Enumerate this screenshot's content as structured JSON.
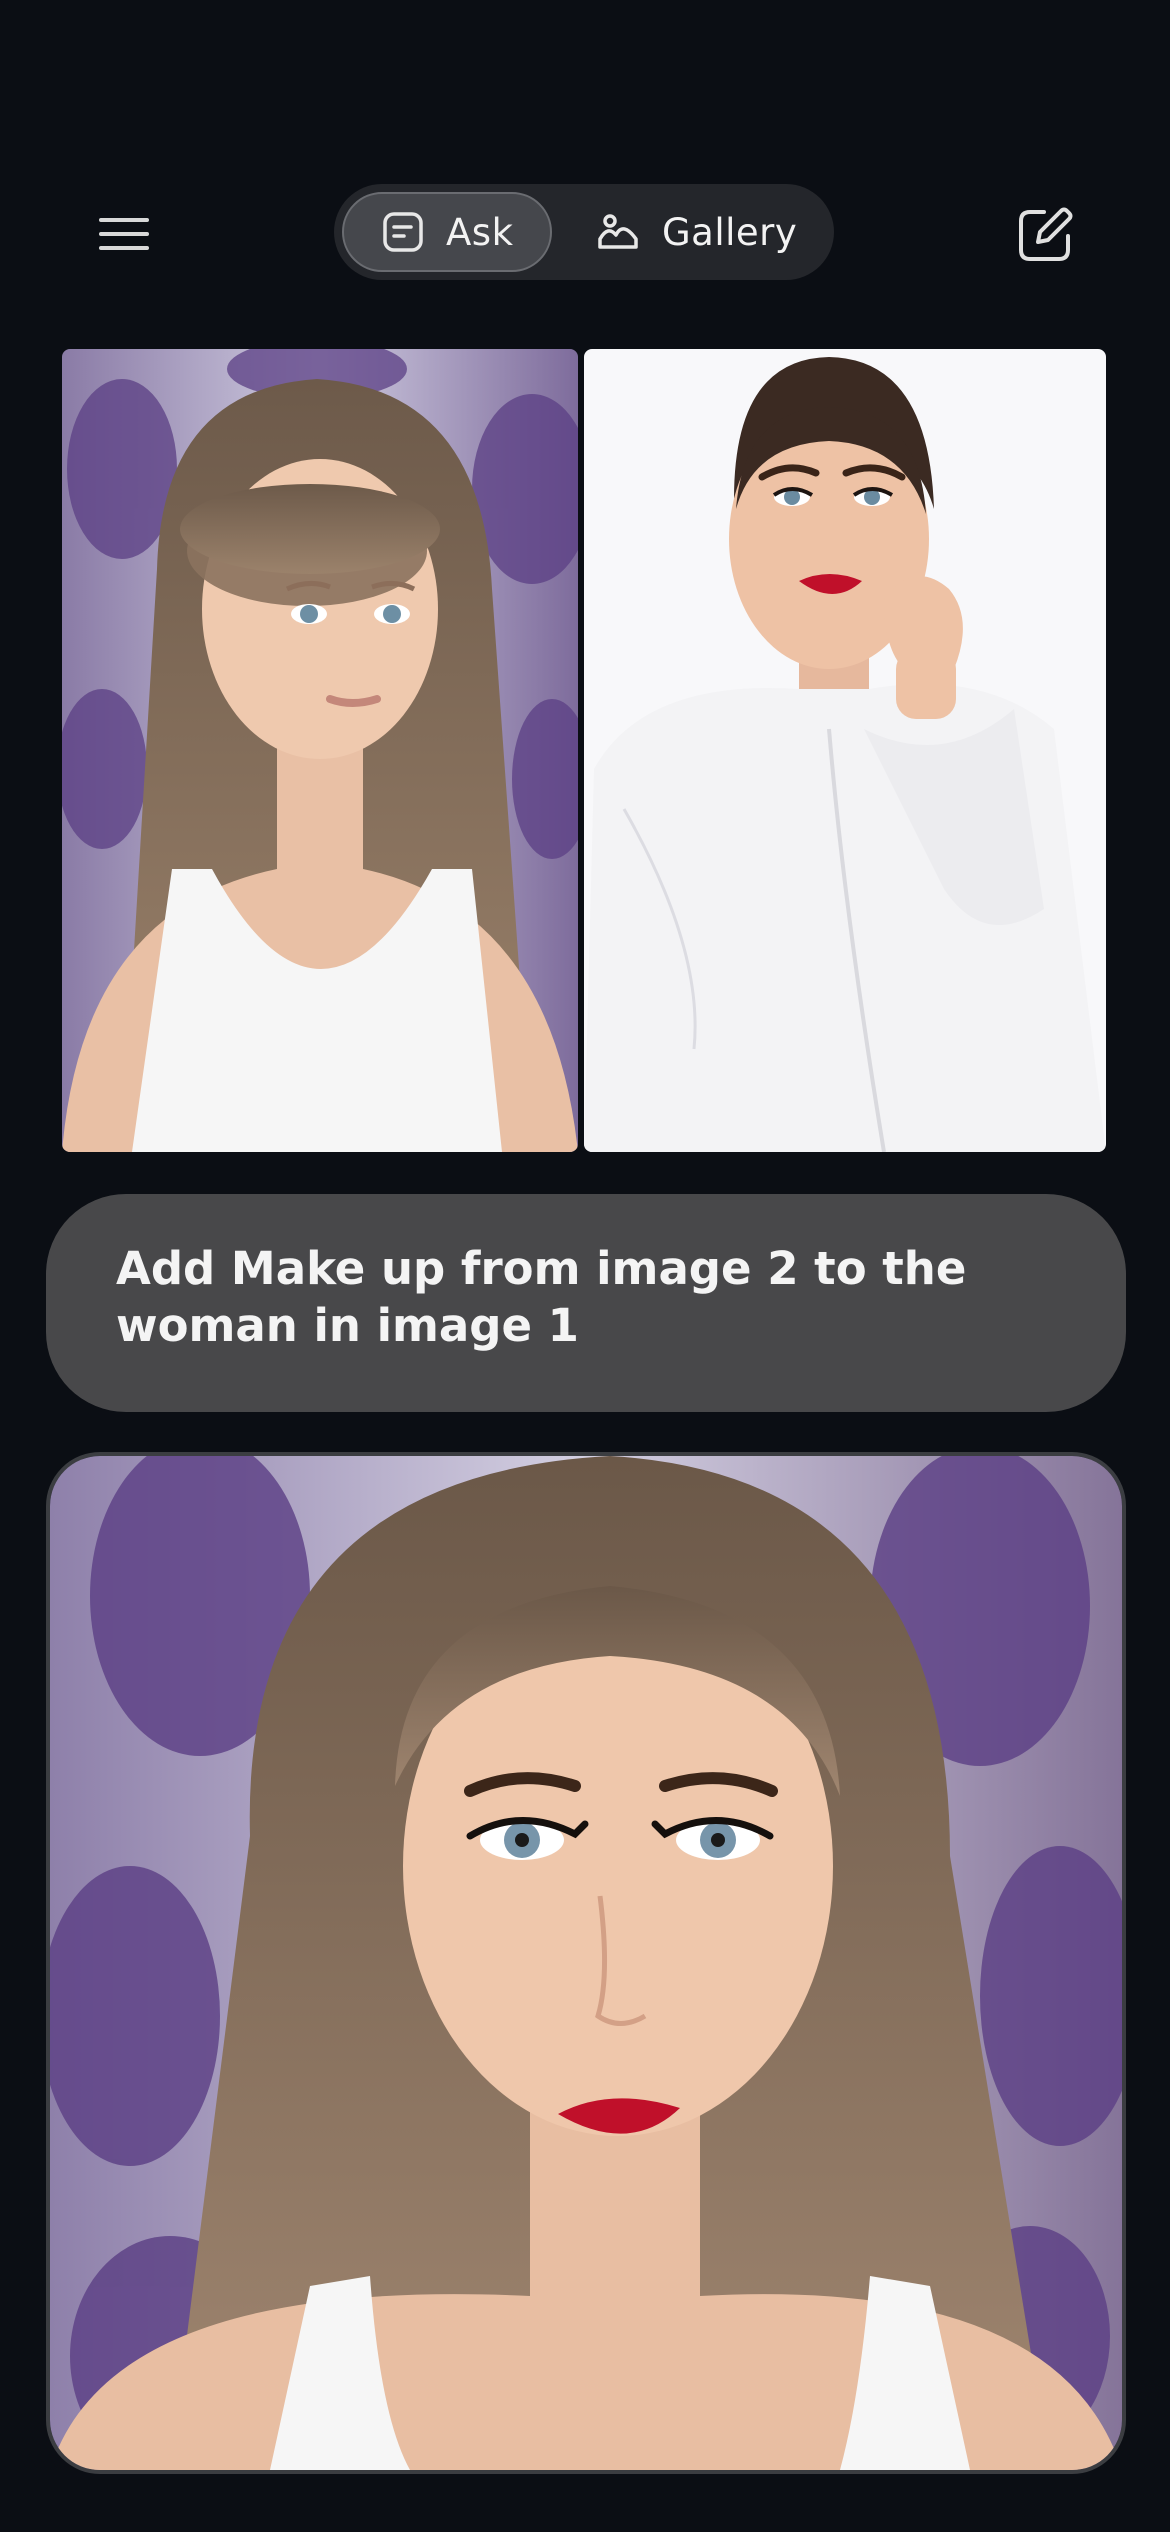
{
  "header": {
    "menu_icon": "hamburger-menu-icon",
    "tabs": [
      {
        "label": "Ask",
        "icon": "chat-note-icon",
        "selected": true
      },
      {
        "label": "Gallery",
        "icon": "gallery-icon",
        "selected": false
      }
    ],
    "compose_icon": "compose-edit-icon"
  },
  "conversation": {
    "input_images": [
      {
        "index": 1,
        "description": "woman without make up"
      },
      {
        "index": 2,
        "description": "woman with red lipstick make up"
      }
    ],
    "user_message": "Add Make up from image 2 to the woman in image 1",
    "result_image": {
      "description": "woman from image 1 with make up applied"
    }
  },
  "colors": {
    "background": "#0b0e14",
    "segment_bg": "#24262b",
    "segment_active": "#45474c",
    "bubble": "#48484a",
    "lipstick": "#c0102a"
  }
}
